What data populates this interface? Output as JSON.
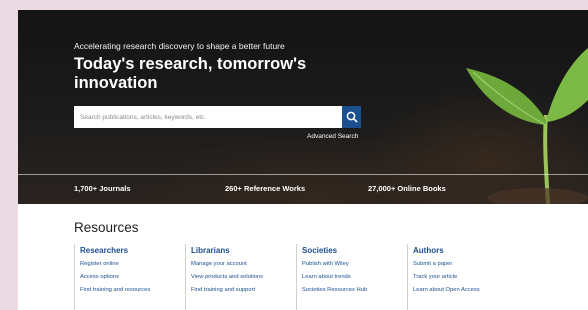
{
  "hero": {
    "tagline": "Accelerating research discovery to shape a better future",
    "headline": "Today's research, tomorrow's innovation",
    "search": {
      "placeholder": "Search publications, articles, keywords, etc.",
      "button_icon": "search-icon"
    },
    "advanced_search": "Advanced Search",
    "stats": [
      "1,700+ Journals",
      "260+ Reference Works",
      "27,000+ Online Books"
    ]
  },
  "resources": {
    "title": "Resources",
    "columns": [
      {
        "heading": "Researchers",
        "links": [
          "Register online",
          "Access options",
          "Find training and resources"
        ]
      },
      {
        "heading": "Librarians",
        "links": [
          "Manage your account",
          "View products and solutions",
          "Find training and support"
        ]
      },
      {
        "heading": "Societies",
        "links": [
          "Publish with Wiley",
          "Learn about trends",
          "Societies Resources Hub"
        ]
      },
      {
        "heading": "Authors",
        "links": [
          "Submit a paper",
          "Track your article",
          "Learn about Open Access"
        ]
      }
    ]
  },
  "colors": {
    "brand_blue": "#1b4f8f",
    "page_bg": "#eadbe3"
  }
}
